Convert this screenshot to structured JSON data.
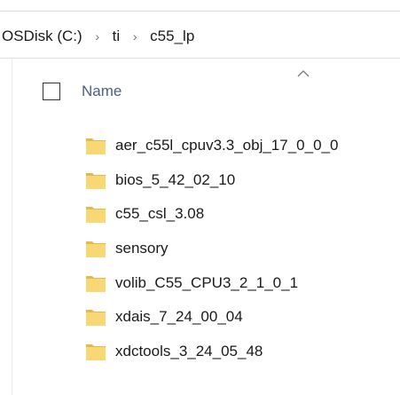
{
  "breadcrumb": {
    "items": [
      "OSDisk (C:)",
      "ti",
      "c55_lp"
    ],
    "separator": "›"
  },
  "columns": {
    "name_label": "Name",
    "sort": "ascending"
  },
  "folders": [
    {
      "name": "aer_c55l_cpuv3.3_obj_17_0_0_0"
    },
    {
      "name": "bios_5_42_02_10"
    },
    {
      "name": "c55_csl_3.08"
    },
    {
      "name": "sensory"
    },
    {
      "name": "volib_C55_CPU3_2_1_0_1"
    },
    {
      "name": "xdais_7_24_00_04"
    },
    {
      "name": "xdctools_3_24_05_48"
    }
  ],
  "colors": {
    "folder_fill": "#f8d775",
    "folder_tab": "#e9b84a",
    "header_text": "#4c607a"
  },
  "icons": {
    "folder": "folder-icon",
    "sort": "sort-up-icon",
    "separator": "chevron-right-icon"
  }
}
